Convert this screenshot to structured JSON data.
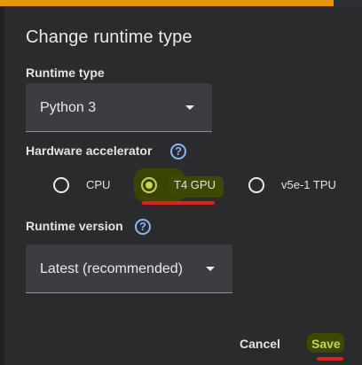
{
  "dialog": {
    "title": "Change runtime type"
  },
  "runtime_type": {
    "label": "Runtime type",
    "selected": "Python 3"
  },
  "hardware_accelerator": {
    "label": "Hardware accelerator",
    "options": [
      {
        "label": "CPU",
        "selected": false
      },
      {
        "label": "T4 GPU",
        "selected": true
      },
      {
        "label": "v5e-1 TPU",
        "selected": false
      }
    ]
  },
  "runtime_version": {
    "label": "Runtime version",
    "selected": "Latest (recommended)"
  },
  "help": {
    "glyph": "?"
  },
  "footer": {
    "cancel_label": "Cancel",
    "save_label": "Save"
  },
  "colors": {
    "accent_orange": "#e8930c",
    "highlight_yellow": "#c6d84a",
    "annotation_red": "#e0201b",
    "help_blue": "#8ab4f8",
    "dialog_bg": "#2a2b2d"
  }
}
